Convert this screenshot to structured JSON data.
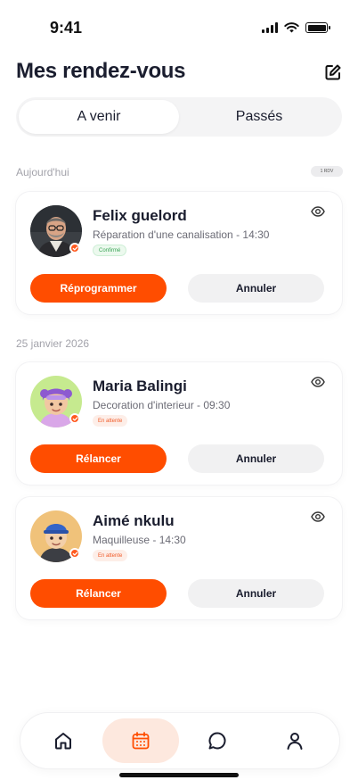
{
  "status_bar": {
    "time": "9:41"
  },
  "header": {
    "title": "Mes rendez-vous"
  },
  "tabs": [
    {
      "label": "A venir",
      "active": true
    },
    {
      "label": "Passés",
      "active": false
    }
  ],
  "sections": [
    {
      "label": "Aujourd'hui",
      "count_badge": "1 RDV",
      "appointments": [
        {
          "name": "Felix guelord",
          "service": "Réparation d'une canalisation - 14:30",
          "status": "Confirmé",
          "primary_action": "Réprogrammer",
          "secondary_action": "Annuler"
        }
      ]
    },
    {
      "label": "25 janvier 2026",
      "appointments": [
        {
          "name": "Maria Balingi",
          "service": "Decoration d'interieur - 09:30",
          "status": "En attente",
          "primary_action": "Rélancer",
          "secondary_action": "Annuler"
        },
        {
          "name": "Aimé nkulu",
          "service": "Maquilleuse - 14:30",
          "status": "En attente",
          "primary_action": "Rélancer",
          "secondary_action": "Annuler"
        }
      ]
    }
  ],
  "bottom_nav": [
    {
      "icon": "home-icon",
      "active": false
    },
    {
      "icon": "calendar-icon",
      "active": true
    },
    {
      "icon": "chat-icon",
      "active": false
    },
    {
      "icon": "profile-icon",
      "active": false
    }
  ],
  "colors": {
    "accent": "#ff4d00",
    "accent_soft": "#fde8de",
    "confirmed": "#3aa457",
    "pending": "#f05a28",
    "text": "#1a1d2e"
  }
}
